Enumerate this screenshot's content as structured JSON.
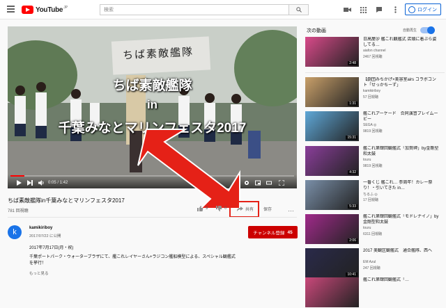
{
  "header": {
    "logo_text": "YouTube",
    "logo_country": "JP",
    "search_placeholder": "検索",
    "login_label": "ログイン"
  },
  "player": {
    "overlay_line1": "ちば素敵艦隊",
    "overlay_line2": "in",
    "overlay_line3": "千葉みなとマリンフェスタ2017",
    "banner_text": "ちば素敵艦隊",
    "time": "0:05 / 1:42",
    "progress": 0.05
  },
  "video": {
    "title": "ちば素敵艦隊in千葉みなとマリンフェスタ2017",
    "views": "781 回視聴",
    "likes": "9",
    "dislikes": "0",
    "share_label": "共有",
    "save_label": "保存"
  },
  "channel": {
    "avatar_letter": "k",
    "name": "kamikiriboy",
    "date": "2017/07/22 に公開",
    "subscribe_label": "チャンネル登録",
    "subscriber_count": "45",
    "description": "2017年7月17日(月・祝)\n千葉ポートパーク・ウォーターブラザにて、艦これレイヤーさん+ラジコン艦船模型による、スペシャル観艦式を挙行！",
    "more_label": "もっと見る"
  },
  "sidebar": {
    "heading": "次の動画",
    "autoplay_label": "自動再生",
    "items": [
      {
        "title": "日高屋＠ 艦これ観艦式 店頭に着ぶら姿してる…",
        "channel": "aiafon channel",
        "views": "2467 回視聴",
        "duration": "2:48",
        "thumb": "#d94a8a"
      },
      {
        "title": "【劇団みちかげ×美容室airs コラボコント「せっかちーず」",
        "channel": "kamikiriboy",
        "views": "57 回視聴",
        "duration": "1:31",
        "thumb": "#c9a06a"
      },
      {
        "title": "艦これアーケード　合同演習プレイムービー",
        "channel": "SEGA ◎",
        "views": "9819 回視聴",
        "duration": "15:31",
        "thumb": "#5fa8d8"
      },
      {
        "title": "艦これ第肆回観艦式「加賀岬」by金剛型和太鼓",
        "channel": "touru",
        "views": "9819 回視聴",
        "duration": "4:32",
        "thumb": "#8a3e9a"
      },
      {
        "title": "一番くじ 艦これ… 参周年！カレー祭り！・引いてきた in…",
        "channel": "ちるふ ◎",
        "views": "17 回視聴",
        "duration": "5:33",
        "thumb": "#7a8fa8"
      },
      {
        "title": "艦これ第肆回観艦式「モドレナイノ」by金剛型和太鼓",
        "channel": "touru",
        "views": "6311 回視聴",
        "duration": "2:06",
        "thumb": "#a02a8a"
      },
      {
        "title": "2017 美観区観艦式　通合艦隊、西へ",
        "channel": "EM Azul",
        "views": "247 回視聴",
        "duration": "10:41",
        "thumb": "#2a2a4a"
      },
      {
        "title": "艦これ第肆回観艦式「…",
        "channel": "",
        "views": "",
        "duration": "",
        "thumb": "#c9487a"
      }
    ]
  },
  "colors": {
    "accent_blue": "#065fd4",
    "subscribe_red": "#cc0000",
    "arrow_red": "#e52117"
  }
}
